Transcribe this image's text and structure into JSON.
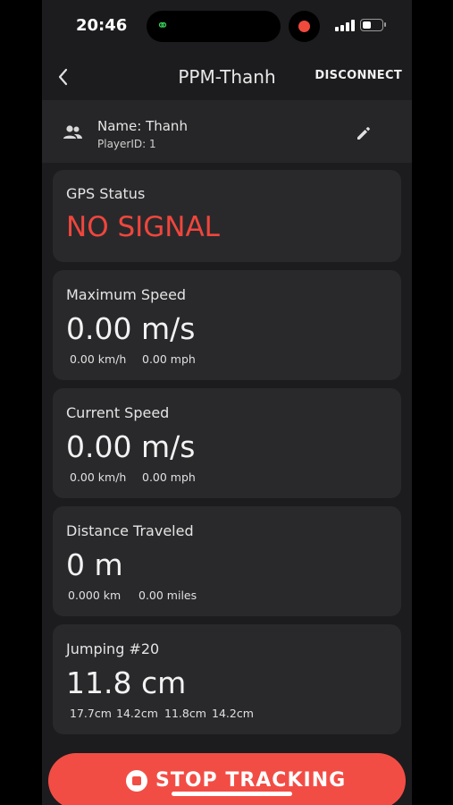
{
  "status_bar": {
    "time": "20:46"
  },
  "nav": {
    "back_icon": "chevron-left-icon",
    "title": "PPM-Thanh",
    "disconnect_label": "DISCONNECT"
  },
  "player": {
    "icon": "people-icon",
    "name": "Name: Thanh",
    "player_id": "PlayerID: 1",
    "edit_icon": "pencil-icon"
  },
  "gps": {
    "title": "GPS Status",
    "value": "NO SIGNAL",
    "value_color": "#f0463c"
  },
  "max_speed": {
    "title": "Maximum Speed",
    "value": "0.00 m/s",
    "kmh": "0.00 km/h",
    "mph": "0.00 mph"
  },
  "current_speed": {
    "title": "Current Speed",
    "value": "0.00 m/s",
    "kmh": "0.00 km/h",
    "mph": "0.00 mph"
  },
  "distance": {
    "title": "Distance Traveled",
    "value": "0 m",
    "km": "0.000 km",
    "miles": "0.00 miles"
  },
  "jumping": {
    "title": "Jumping #20",
    "value": "11.8 cm",
    "history": [
      "17.7cm",
      "14.2cm",
      "11.8cm",
      "14.2cm"
    ]
  },
  "stop_button": {
    "label": "STOP TRACKING",
    "color": "#f24d45"
  }
}
